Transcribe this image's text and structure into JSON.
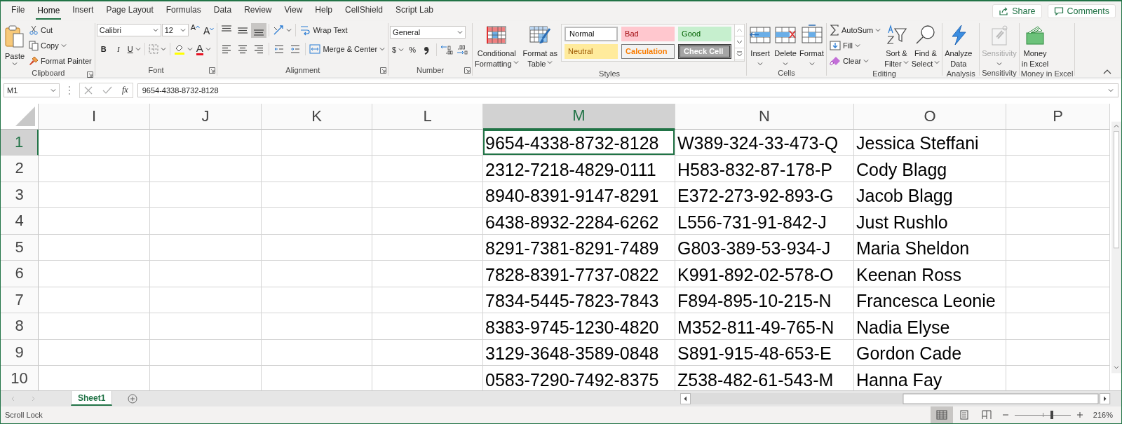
{
  "ribbon_tabs": [
    {
      "label": "File",
      "selected": false
    },
    {
      "label": "Home",
      "selected": true
    },
    {
      "label": "Insert",
      "selected": false
    },
    {
      "label": "Page Layout",
      "selected": false
    },
    {
      "label": "Formulas",
      "selected": false
    },
    {
      "label": "Data",
      "selected": false
    },
    {
      "label": "Review",
      "selected": false
    },
    {
      "label": "View",
      "selected": false
    },
    {
      "label": "Help",
      "selected": false
    },
    {
      "label": "CellShield",
      "selected": false
    },
    {
      "label": "Script Lab",
      "selected": false
    }
  ],
  "share_button": "Share",
  "comments_button": "Comments",
  "ribbon": {
    "clipboard": {
      "label": "Clipboard",
      "paste": "Paste",
      "cut": "Cut",
      "copy": "Copy",
      "format_painter": "Format Painter"
    },
    "font": {
      "label": "Font",
      "font_name": "Calibri",
      "font_size": "12",
      "grow_font": "A",
      "shrink_font": "A",
      "format_buttons": [
        {
          "label": "B",
          "kind": "bold"
        },
        {
          "label": "I",
          "kind": "italic"
        },
        {
          "label": "U",
          "kind": "underline"
        }
      ],
      "font_color": "A"
    },
    "alignment": {
      "label": "Alignment",
      "vertical_align": [
        {
          "selected": false
        },
        {
          "selected": false
        },
        {
          "selected": true
        }
      ],
      "wrap_text": "Wrap Text",
      "merge_center": "Merge & Center"
    },
    "number": {
      "label": "Number",
      "format": "General",
      "currency": "$",
      "percent": "%"
    },
    "styles": {
      "label": "Styles",
      "conditional_formatting": [
        "Conditional",
        "Formatting"
      ],
      "format_as_table": [
        "Format as",
        "Table"
      ],
      "gallery": [
        {
          "label": "Normal",
          "kind": "normal"
        },
        {
          "label": "Bad",
          "kind": "bad"
        },
        {
          "label": "Good",
          "kind": "good"
        },
        {
          "label": "Neutral",
          "kind": "neutral"
        },
        {
          "label": "Calculation",
          "kind": "calculation"
        },
        {
          "label": "Check Cell",
          "kind": "check"
        }
      ]
    },
    "cells": {
      "label": "Cells",
      "insert": "Insert",
      "delete": "Delete",
      "format": "Format"
    },
    "editing": {
      "label": "Editing",
      "autosum": "AutoSum",
      "fill": "Fill",
      "clear": "Clear",
      "sort_filter": [
        "Sort &",
        "Filter"
      ],
      "find_select": [
        "Find &",
        "Select"
      ]
    },
    "analysis": {
      "label": "Analysis",
      "analyze_data": [
        "Analyze",
        "Data"
      ]
    },
    "sensitivity": {
      "label": "Sensitivity",
      "button": "Sensitivity",
      "disabled": true
    },
    "money": {
      "label": "Money in Excel",
      "button": [
        "Money",
        "in Excel"
      ]
    }
  },
  "formula_bar": {
    "name_box": "M1",
    "insert_function": "fx",
    "formula": "9654-4338-8732-8128"
  },
  "grid": {
    "columns": [
      {
        "label": "I",
        "selected": false
      },
      {
        "label": "J",
        "selected": false
      },
      {
        "label": "K",
        "selected": false
      },
      {
        "label": "L",
        "selected": false
      },
      {
        "label": "M",
        "selected": true
      },
      {
        "label": "N",
        "selected": false
      },
      {
        "label": "O",
        "selected": false
      },
      {
        "label": "P",
        "selected": false
      }
    ],
    "rows": [
      {
        "number": "1",
        "selected": true,
        "cells": [
          null,
          null,
          null,
          null,
          "9654-4338-8732-8128",
          "W389-324-33-473-Q",
          "Jessica Steffani",
          null
        ]
      },
      {
        "number": "2",
        "selected": false,
        "cells": [
          null,
          null,
          null,
          null,
          "2312-7218-4829-0111",
          "H583-832-87-178-P",
          "Cody Blagg",
          null
        ]
      },
      {
        "number": "3",
        "selected": false,
        "cells": [
          null,
          null,
          null,
          null,
          "8940-8391-9147-8291",
          "E372-273-92-893-G",
          "Jacob Blagg",
          null
        ]
      },
      {
        "number": "4",
        "selected": false,
        "cells": [
          null,
          null,
          null,
          null,
          "6438-8932-2284-6262",
          "L556-731-91-842-J",
          "Just Rushlo",
          null
        ]
      },
      {
        "number": "5",
        "selected": false,
        "cells": [
          null,
          null,
          null,
          null,
          "8291-7381-8291-7489",
          "G803-389-53-934-J",
          "Maria Sheldon",
          null
        ]
      },
      {
        "number": "6",
        "selected": false,
        "cells": [
          null,
          null,
          null,
          null,
          "7828-8391-7737-0822",
          "K991-892-02-578-O",
          "Keenan Ross",
          null
        ]
      },
      {
        "number": "7",
        "selected": false,
        "cells": [
          null,
          null,
          null,
          null,
          "7834-5445-7823-7843",
          "F894-895-10-215-N",
          "Francesca Leonie",
          null
        ]
      },
      {
        "number": "8",
        "selected": false,
        "cells": [
          null,
          null,
          null,
          null,
          "8383-9745-1230-4820",
          "M352-811-49-765-N",
          "Nadia Elyse",
          null
        ]
      },
      {
        "number": "9",
        "selected": false,
        "cells": [
          null,
          null,
          null,
          null,
          "3129-3648-3589-0848",
          "S891-915-48-653-E",
          "Gordon Cade",
          null
        ]
      },
      {
        "number": "10",
        "selected": false,
        "cells": [
          null,
          null,
          null,
          null,
          "0583-7290-7492-8375",
          "Z538-482-61-543-M",
          "Hanna Fay",
          null
        ]
      }
    ]
  },
  "sheet_tabs": [
    {
      "label": "Sheet1",
      "selected": true
    }
  ],
  "status_bar": {
    "text": "Scroll Lock",
    "views": [
      {
        "selected": true
      },
      {
        "selected": false
      },
      {
        "selected": false
      }
    ],
    "zoom": {
      "level": 0.67,
      "reading": "216%"
    }
  }
}
